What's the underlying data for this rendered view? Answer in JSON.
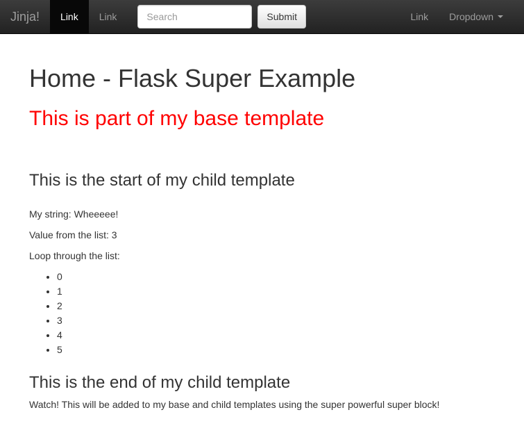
{
  "navbar": {
    "brand": "Jinja!",
    "left_links": [
      {
        "label": "Link",
        "active": true
      },
      {
        "label": "Link",
        "active": false
      }
    ],
    "search": {
      "placeholder": "Search",
      "value": ""
    },
    "submit_label": "Submit",
    "right_links": [
      {
        "label": "Link"
      }
    ],
    "dropdown_label": "Dropdown"
  },
  "content": {
    "title": "Home - Flask Super Example",
    "base_heading": "This is part of my base template",
    "child_start_heading": "This is the start of my child template",
    "string_line_label": "My string: ",
    "string_line_value": "Wheeeee!",
    "list_value_label": "Value from the list: ",
    "list_value": "3",
    "loop_label": "Loop through the list:",
    "list_items": [
      "0",
      "1",
      "2",
      "3",
      "4",
      "5"
    ],
    "child_end_heading": "This is the end of my child template",
    "super_text": "Watch! This will be added to my base and child templates using the super powerful super block!"
  }
}
